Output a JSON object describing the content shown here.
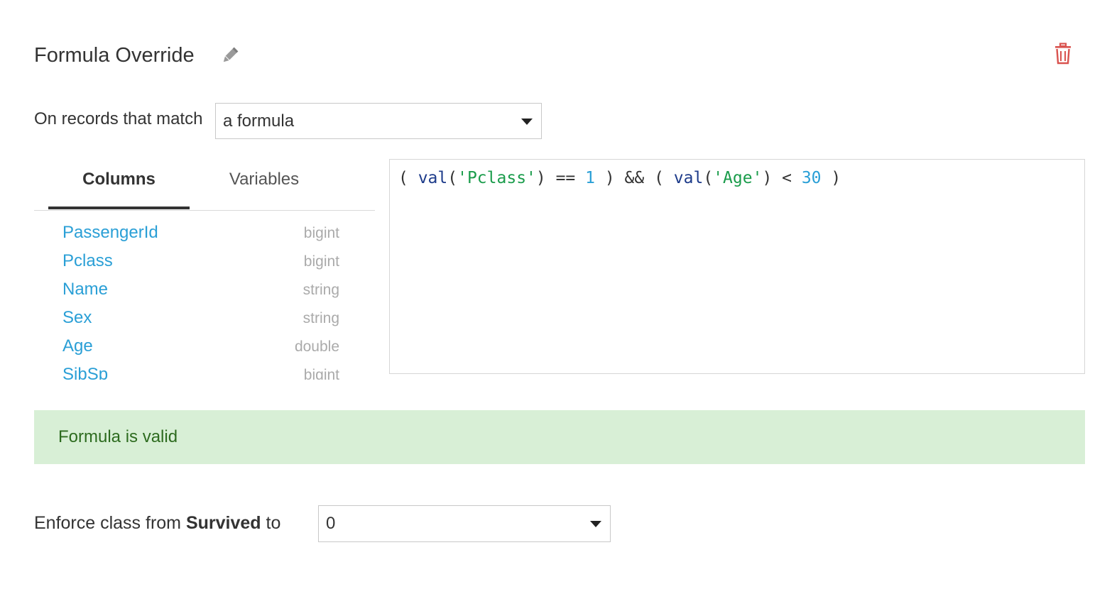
{
  "header": {
    "title": "Formula Override",
    "edit_icon": "pencil-icon",
    "delete_icon": "trash-icon",
    "delete_color": "#d9534f"
  },
  "match": {
    "label": "On records that match",
    "selected": "a formula"
  },
  "tabs": [
    {
      "label": "Columns",
      "active": true
    },
    {
      "label": "Variables",
      "active": false
    }
  ],
  "columns": [
    {
      "name": "PassengerId",
      "type": "bigint"
    },
    {
      "name": "Pclass",
      "type": "bigint"
    },
    {
      "name": "Name",
      "type": "string"
    },
    {
      "name": "Sex",
      "type": "string"
    },
    {
      "name": "Age",
      "type": "double"
    },
    {
      "name": "SibSp",
      "type": "bigint"
    }
  ],
  "editor": {
    "tokens": [
      {
        "t": "( ",
        "k": "op"
      },
      {
        "t": "val",
        "k": "fn"
      },
      {
        "t": "(",
        "k": "op"
      },
      {
        "t": "'Pclass'",
        "k": "str"
      },
      {
        "t": ") == ",
        "k": "op"
      },
      {
        "t": "1",
        "k": "num"
      },
      {
        "t": " ) && ( ",
        "k": "op"
      },
      {
        "t": "val",
        "k": "fn"
      },
      {
        "t": "(",
        "k": "op"
      },
      {
        "t": "'Age'",
        "k": "str"
      },
      {
        "t": ") < ",
        "k": "op"
      },
      {
        "t": "30",
        "k": "num"
      },
      {
        "t": " )",
        "k": "op"
      }
    ]
  },
  "validation": {
    "message": "Formula is valid",
    "bg_color": "#d8efd6",
    "text_color": "#2d6b1f"
  },
  "enforce": {
    "prefix": "Enforce class from ",
    "column": "Survived",
    "suffix": " to",
    "selected": "0"
  },
  "colors": {
    "link": "#2a9fd6",
    "type": "#aaaaaa"
  }
}
